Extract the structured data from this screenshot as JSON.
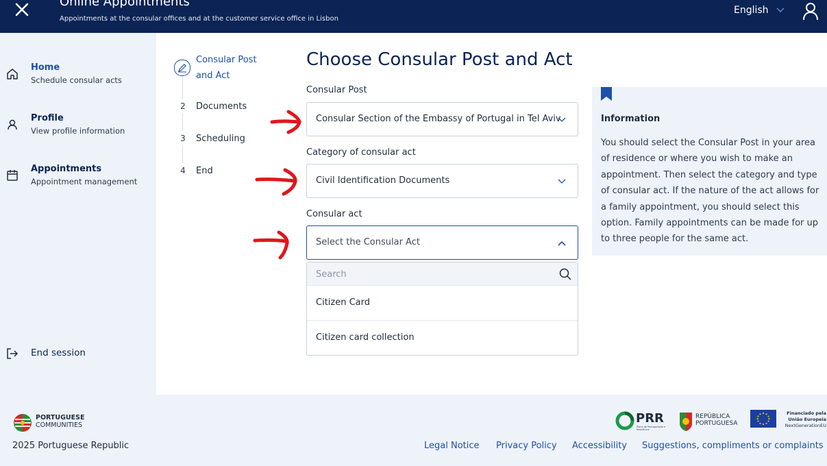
{
  "header": {
    "title": "Online Appointments",
    "subtitle": "Appointments at the consular offices and at the customer service office in Lisbon",
    "language": "English"
  },
  "sidebar": {
    "items": [
      {
        "title": "Home",
        "subtitle": "Schedule consular acts",
        "icon": "home-icon"
      },
      {
        "title": "Profile",
        "subtitle": "View profile information",
        "icon": "person-icon"
      },
      {
        "title": "Appointments",
        "subtitle": "Appointment management",
        "icon": "calendar-icon"
      }
    ],
    "end_session": "End session"
  },
  "stepper": {
    "steps": [
      {
        "number": "1",
        "label_line1": "Consular Post",
        "label_line2": "and Act",
        "active": true
      },
      {
        "number": "2",
        "label": "Documents"
      },
      {
        "number": "3",
        "label": "Scheduling"
      },
      {
        "number": "4",
        "label": "End"
      }
    ]
  },
  "main": {
    "title": "Choose Consular Post and Act",
    "consular_post": {
      "label": "Consular Post",
      "value": "Consular Section of the Embassy of Portugal in Tel Aviv"
    },
    "category": {
      "label": "Category of consular act",
      "value": "Civil Identification Documents"
    },
    "consular_act": {
      "label": "Consular act",
      "placeholder": "Select the Consular Act",
      "search_placeholder": "Search",
      "options": [
        "Citizen Card",
        "Citizen card collection"
      ]
    }
  },
  "info": {
    "title": "Information",
    "text": "You should select the Consular Post in your area of residence or where you wish to make an appointment. Then select the category and type of consular act. If the nature of the act allows for a family appointment, you should select this option. Family appointments can be made for up to three people for the same act."
  },
  "footer": {
    "brand_line1": "PORTUGUESE",
    "brand_line2": "COMMUNITIES",
    "copyright": "2025 Portuguese Republic",
    "links": [
      "Legal Notice",
      "Privacy Policy",
      "Accessibility",
      "Suggestions, compliments or complaints"
    ],
    "prr": "PRR",
    "prr_sub": "Plano de Recuperação e Resiliência",
    "republic_line1": "REPÚBLICA",
    "republic_line2": "PORTUGUESA",
    "eu_line1": "Financiado pela",
    "eu_line2": "União Europeia",
    "eu_line3": "NextGenerationEU"
  },
  "colors": {
    "header_bg": "#0b2455",
    "accent": "#1f4fa8",
    "sidebar_bg": "#eef3fa",
    "annotation_arrow": "#e0161d"
  }
}
